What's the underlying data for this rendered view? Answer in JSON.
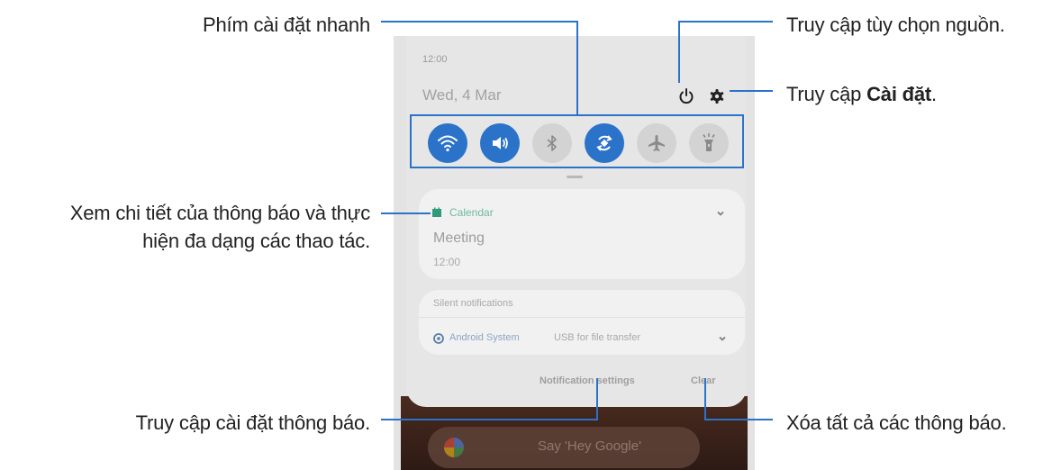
{
  "callouts": {
    "quick_settings": "Phím cài đặt nhanh",
    "power_options": "Truy cập tùy chọn nguồn.",
    "settings_prefix": "Truy cập ",
    "settings_bold": "Cài đặt",
    "settings_suffix": ".",
    "notif_detail_line1": "Xem chi tiết của thông báo và thực",
    "notif_detail_line2": "hiện đa dạng các thao tác.",
    "notif_settings": "Truy cập cài đặt thông báo.",
    "clear_all": "Xóa tất cả các thông báo."
  },
  "phone": {
    "time": "12:00",
    "date": "Wed, 4 Mar",
    "quick_settings": [
      {
        "icon": "wifi-icon",
        "state": "on"
      },
      {
        "icon": "sound-icon",
        "state": "on"
      },
      {
        "icon": "bluetooth-icon",
        "state": "off"
      },
      {
        "icon": "auto-rotate-icon",
        "state": "on"
      },
      {
        "icon": "airplane-icon",
        "state": "off"
      },
      {
        "icon": "flashlight-icon",
        "state": "off"
      }
    ],
    "notification": {
      "app": "Calendar",
      "title": "Meeting",
      "time": "12:00"
    },
    "silent": {
      "header": "Silent notifications",
      "app": "Android System",
      "text": "USB for file transfer"
    },
    "buttons": {
      "settings": "Notification settings",
      "clear": "Clear"
    },
    "search_placeholder": "Say 'Hey Google'"
  },
  "colors": {
    "accent": "#2b73c9",
    "callout_line": "#2b73c9"
  }
}
